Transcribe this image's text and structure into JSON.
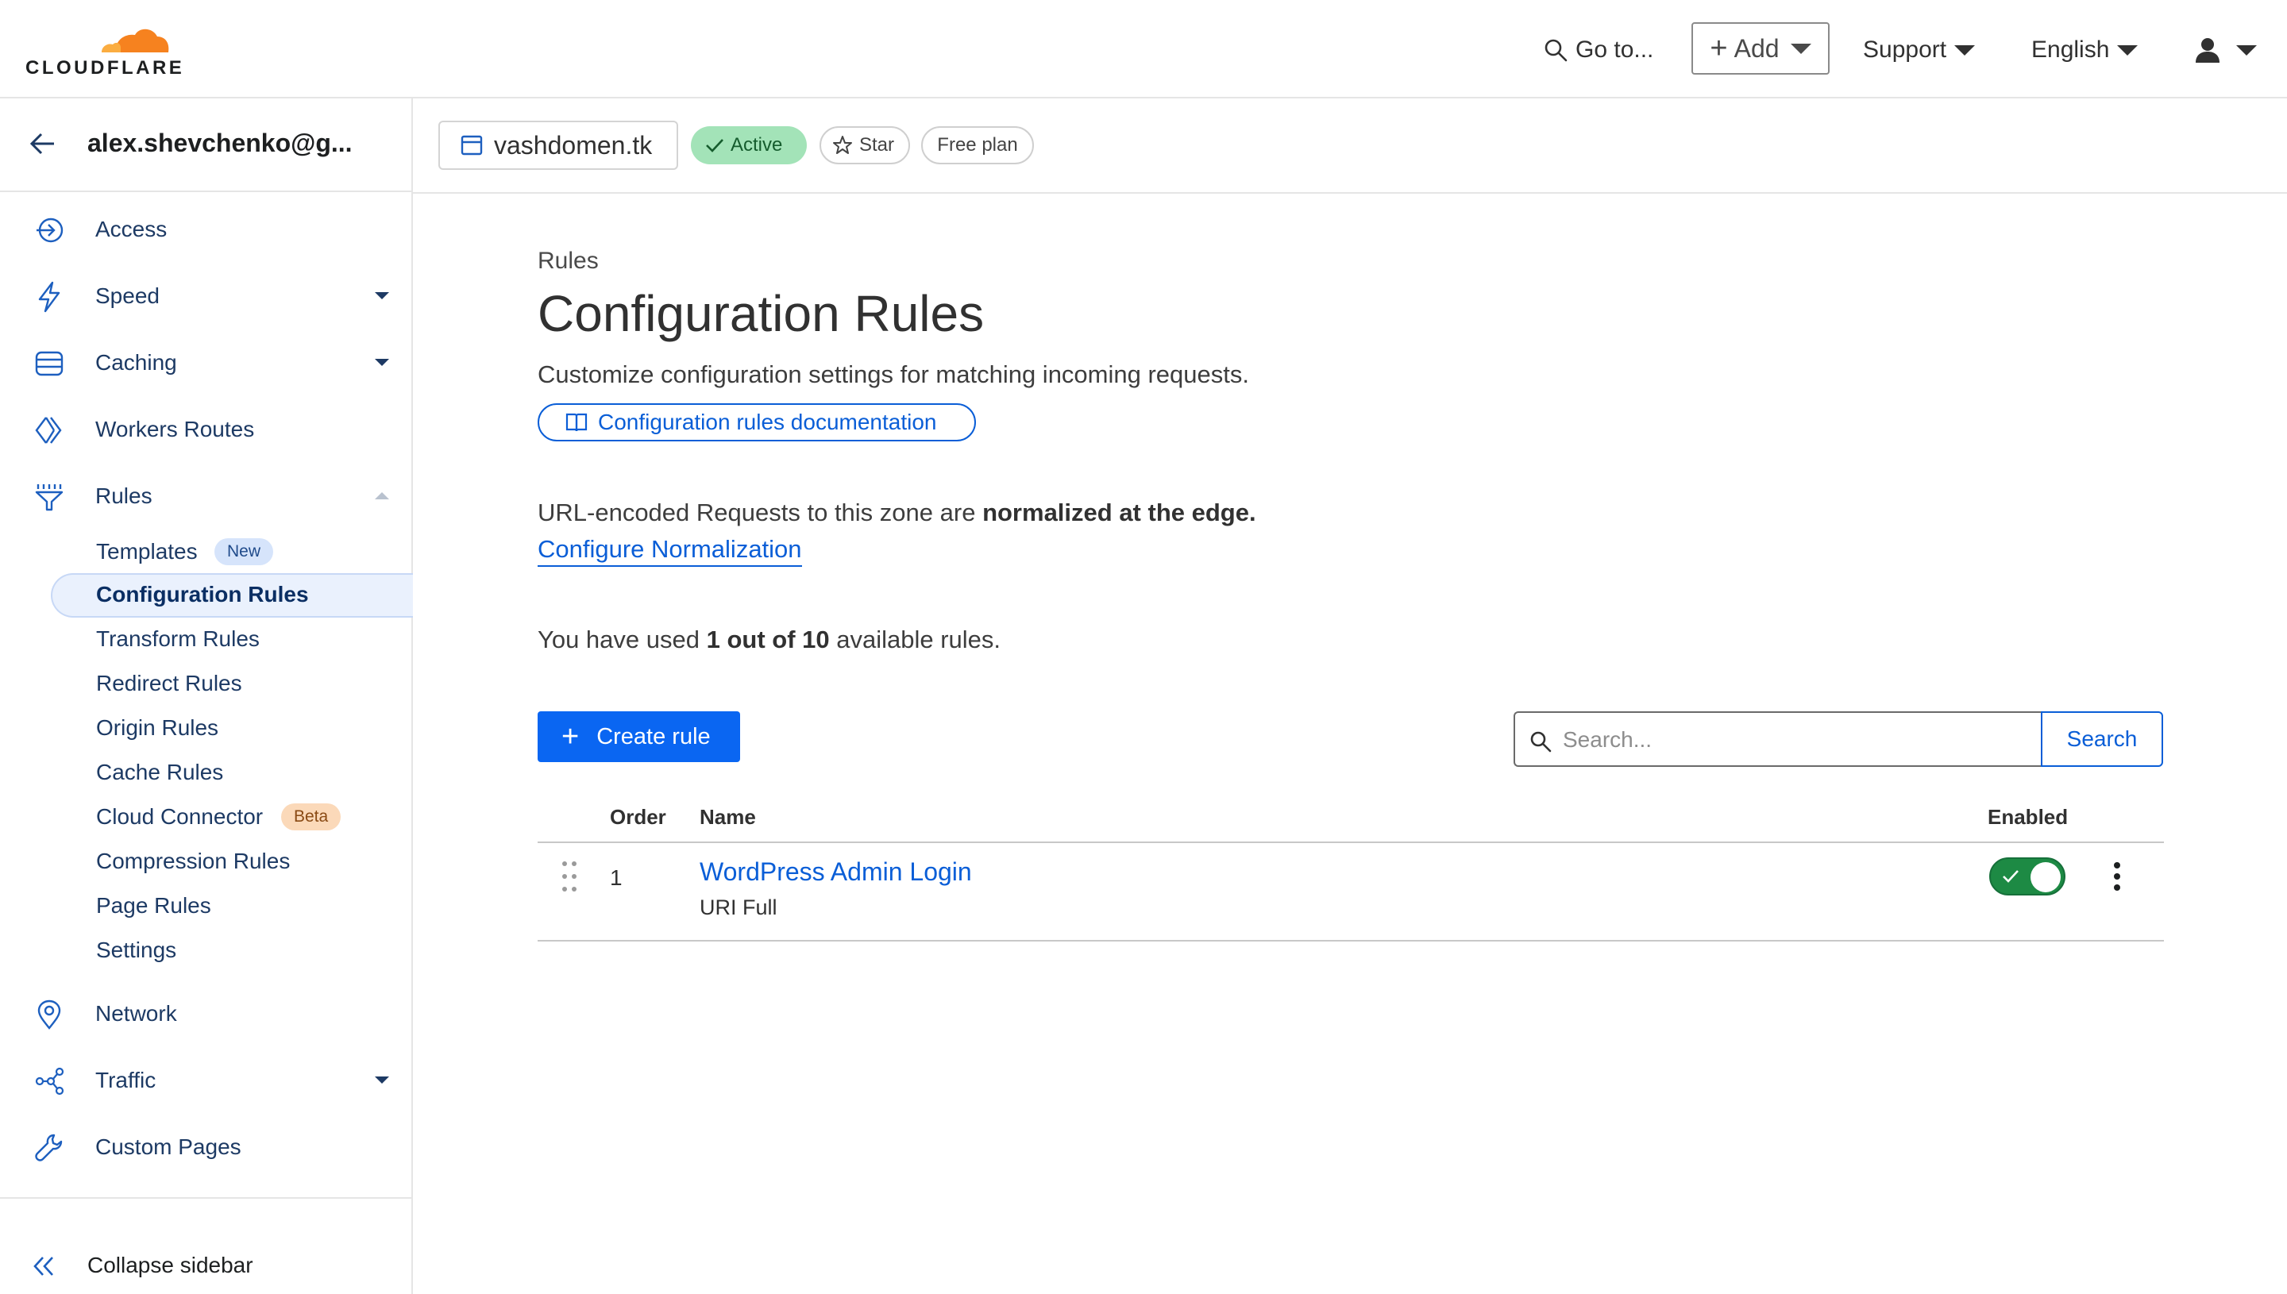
{
  "header": {
    "logo_text": "CLOUDFLARE",
    "goto_label": "Go to...",
    "add_label": "Add",
    "support_label": "Support",
    "language_label": "English"
  },
  "sidebar": {
    "account_name": "alex.shevchenko@g...",
    "items": [
      {
        "label": "Access",
        "icon": "access-icon"
      },
      {
        "label": "Speed",
        "icon": "bolt-icon"
      },
      {
        "label": "Caching",
        "icon": "server-stack-icon"
      },
      {
        "label": "Workers Routes",
        "icon": "workers-icon"
      },
      {
        "label": "Rules",
        "icon": "funnel-icon"
      }
    ],
    "rules_subitems": [
      {
        "label": "Templates",
        "badge": "New"
      },
      {
        "label": "Configuration Rules"
      },
      {
        "label": "Transform Rules"
      },
      {
        "label": "Redirect Rules"
      },
      {
        "label": "Origin Rules"
      },
      {
        "label": "Cache Rules"
      },
      {
        "label": "Cloud Connector",
        "badge": "Beta"
      },
      {
        "label": "Compression Rules"
      },
      {
        "label": "Page Rules"
      },
      {
        "label": "Settings"
      }
    ],
    "bottom_items": [
      {
        "label": "Network",
        "icon": "map-pin-icon"
      },
      {
        "label": "Traffic",
        "icon": "network-nodes-icon"
      },
      {
        "label": "Custom Pages",
        "icon": "wrench-icon"
      }
    ],
    "collapse_label": "Collapse sidebar"
  },
  "zone": {
    "domain": "vashdomen.tk",
    "status": "Active",
    "star_label": "Star",
    "plan_label": "Free plan"
  },
  "main": {
    "breadcrumb": "Rules",
    "title": "Configuration Rules",
    "description": "Customize configuration settings for matching incoming requests.",
    "doc_link": "Configuration rules documentation",
    "normalization_prefix": "URL-encoded Requests to this zone are",
    "normalization_bold": "normalized at the edge.",
    "normalization_link": "Configure Normalization",
    "usage_prefix": "You have used",
    "usage_bold": "1 out of 10",
    "usage_suffix": "available rules.",
    "create_rule_label": "Create rule",
    "search_placeholder": "Search...",
    "search_button": "Search"
  },
  "table": {
    "columns": [
      "Order",
      "Name",
      "Enabled"
    ],
    "rows": [
      {
        "order": "1",
        "name": "WordPress Admin Login",
        "subtitle": "URI Full",
        "enabled": true
      }
    ]
  },
  "colors": {
    "accent": "#0a5ed7",
    "primary_button": "#0a66f2",
    "active_pill": "#a3e3b8",
    "toggle_on": "#1d8a44",
    "brand_orange": "#f6821f"
  }
}
